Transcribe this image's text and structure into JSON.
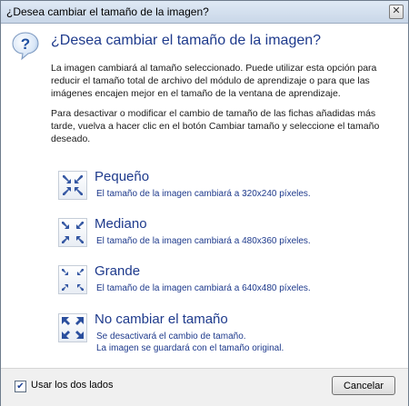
{
  "window": {
    "title": "¿Desea cambiar el tamaño de la imagen?",
    "close_glyph": "✕"
  },
  "dialog": {
    "heading": "¿Desea cambiar el tamaño de la imagen?",
    "paragraph1": "La imagen cambiará al tamaño seleccionado. Puede utilizar esta opción para reducir el tamaño total de archivo del módulo de aprendizaje o para que las imágenes encajen mejor en el tamaño de la ventana de aprendizaje.",
    "paragraph2": "Para desactivar o modificar el cambio de tamaño de las fichas añadidas más tarde, vuelva a hacer clic en el botón Cambiar tamaño y seleccione el tamaño deseado."
  },
  "options": [
    {
      "title": "Pequeño",
      "desc_line1": "El tamaño de la imagen cambiará a 320x240 píxeles.",
      "desc_line2": "",
      "icon": "shrink-small-icon"
    },
    {
      "title": "Mediano",
      "desc_line1": "El tamaño de la imagen cambiará a 480x360 píxeles.",
      "desc_line2": "",
      "icon": "shrink-medium-icon"
    },
    {
      "title": "Grande",
      "desc_line1": "El tamaño de la imagen cambiará a 640x480 píxeles.",
      "desc_line2": "",
      "icon": "shrink-large-icon"
    },
    {
      "title": "No cambiar el tamaño",
      "desc_line1": "Se desactivará el cambio de tamaño.",
      "desc_line2": "La imagen se guardará con el tamaño original.",
      "icon": "expand-icon"
    }
  ],
  "footer": {
    "checkbox_label": "Usar los dos lados",
    "checkbox_checked": true,
    "check_glyph": "✔",
    "cancel_label": "Cancelar"
  },
  "colors": {
    "link_blue": "#1e3a8c",
    "arrow_blue": "#2b4f9e"
  }
}
